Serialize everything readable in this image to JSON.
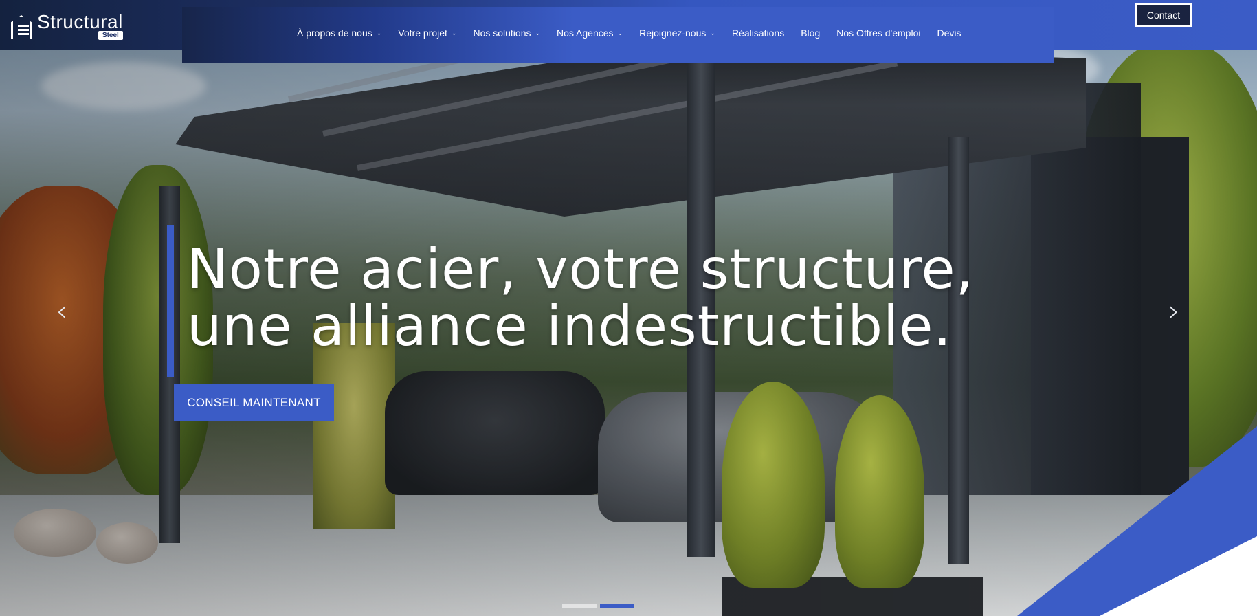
{
  "header": {
    "logo": {
      "name": "Structural",
      "sub": "Steel"
    },
    "nav": [
      {
        "label": "À propos de nous",
        "dropdown": true
      },
      {
        "label": "Votre projet",
        "dropdown": true
      },
      {
        "label": "Nos solutions",
        "dropdown": true
      },
      {
        "label": "Nos Agences",
        "dropdown": true
      },
      {
        "label": "Rejoignez-nous",
        "dropdown": true
      },
      {
        "label": "Réalisations",
        "dropdown": false
      },
      {
        "label": "Blog",
        "dropdown": false
      },
      {
        "label": "Nos Offres d'emploi",
        "dropdown": false
      },
      {
        "label": "Devis",
        "dropdown": false
      }
    ],
    "contact_label": "Contact"
  },
  "hero": {
    "headline_line1": "Notre acier, votre structure,",
    "headline_line2": "une alliance indestructible.",
    "cta_label": "CONSEIL MAINTENANT",
    "prev_glyph": "‹",
    "next_glyph": "›",
    "slides": {
      "count": 2,
      "active_index": 1
    }
  },
  "colors": {
    "accent": "#3b5cc6",
    "header_dark": "#14223f",
    "contact_bg": "#1a2340"
  },
  "icons": {
    "dropdown": "chevron-down-icon",
    "prev": "chevron-left-icon",
    "next": "chevron-right-icon"
  }
}
